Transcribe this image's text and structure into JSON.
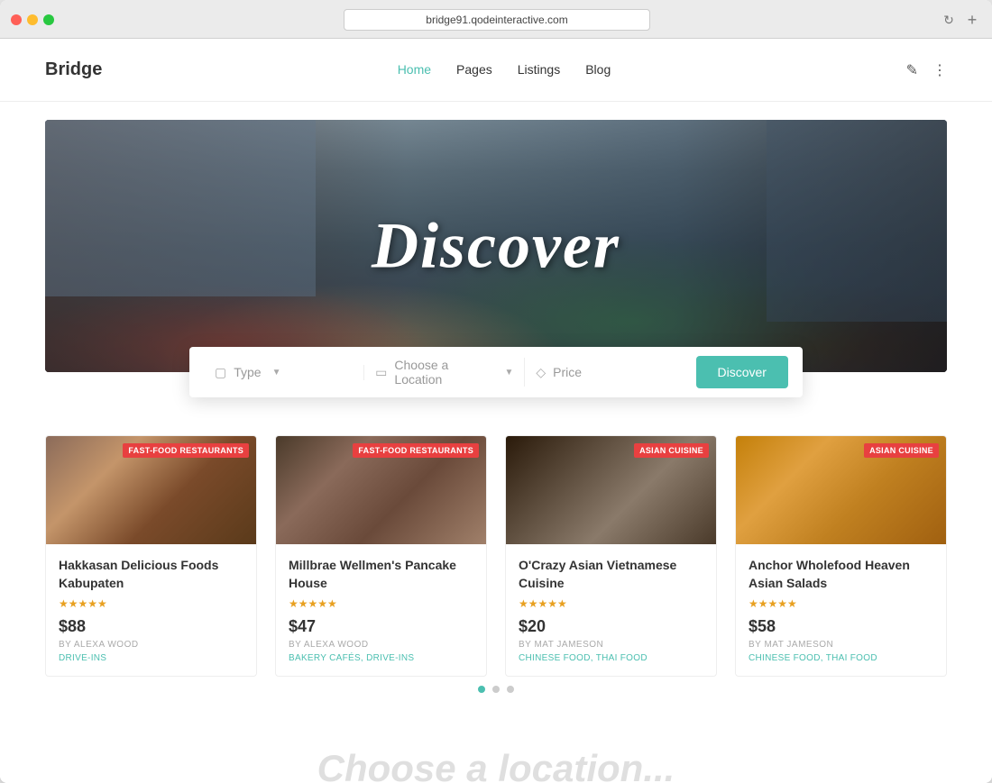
{
  "browser": {
    "url": "bridge91.qodeinteractive.com",
    "refresh_icon": "↻",
    "new_tab_icon": "+"
  },
  "nav": {
    "logo": "Bridge",
    "links": [
      {
        "label": "Home",
        "active": true
      },
      {
        "label": "Pages",
        "active": false
      },
      {
        "label": "Listings",
        "active": false
      },
      {
        "label": "Blog",
        "active": false
      }
    ]
  },
  "hero": {
    "title": "Discover",
    "search": {
      "type_label": "Type",
      "location_label": "Choose a Location",
      "price_label": "Price",
      "discover_button": "Discover"
    }
  },
  "listings": {
    "cards": [
      {
        "badge": "FAST-FOOD RESTAURANTS",
        "badge_color": "red",
        "title": "Hakkasan Delicious Foods Kabupaten",
        "stars": 5,
        "price": "$88",
        "author": "BY ALEXA WOOD",
        "tags": "DRIVE-INS",
        "img_class": "card-img-1"
      },
      {
        "badge": "FAST-FOOD RESTAURANTS",
        "badge_color": "red",
        "title": "Millbrae Wellmen's Pancake House",
        "stars": 5,
        "price": "$47",
        "author": "BY ALEXA WOOD",
        "tags": "BAKERY CAFÉS, DRIVE-INS",
        "img_class": "card-img-2"
      },
      {
        "badge": "ASIAN CUISINE",
        "badge_color": "red",
        "title": "O'Crazy Asian Vietnamese Cuisine",
        "stars": 5,
        "price": "$20",
        "author": "BY MAT JAMESON",
        "tags": "CHINESE FOOD, THAI FOOD",
        "img_class": "card-img-3"
      },
      {
        "badge": "ASIAN CUISINE",
        "badge_color": "red",
        "title": "Anchor Wholefood Heaven Asian Salads",
        "stars": 5,
        "price": "$58",
        "author": "BY MAT JAMESON",
        "tags": "CHINESE FOOD, THAI FOOD",
        "img_class": "card-img-4"
      }
    ],
    "pagination": [
      {
        "active": true
      },
      {
        "active": false
      },
      {
        "active": false
      }
    ]
  },
  "bottom": {
    "text": "Choose a location..."
  }
}
